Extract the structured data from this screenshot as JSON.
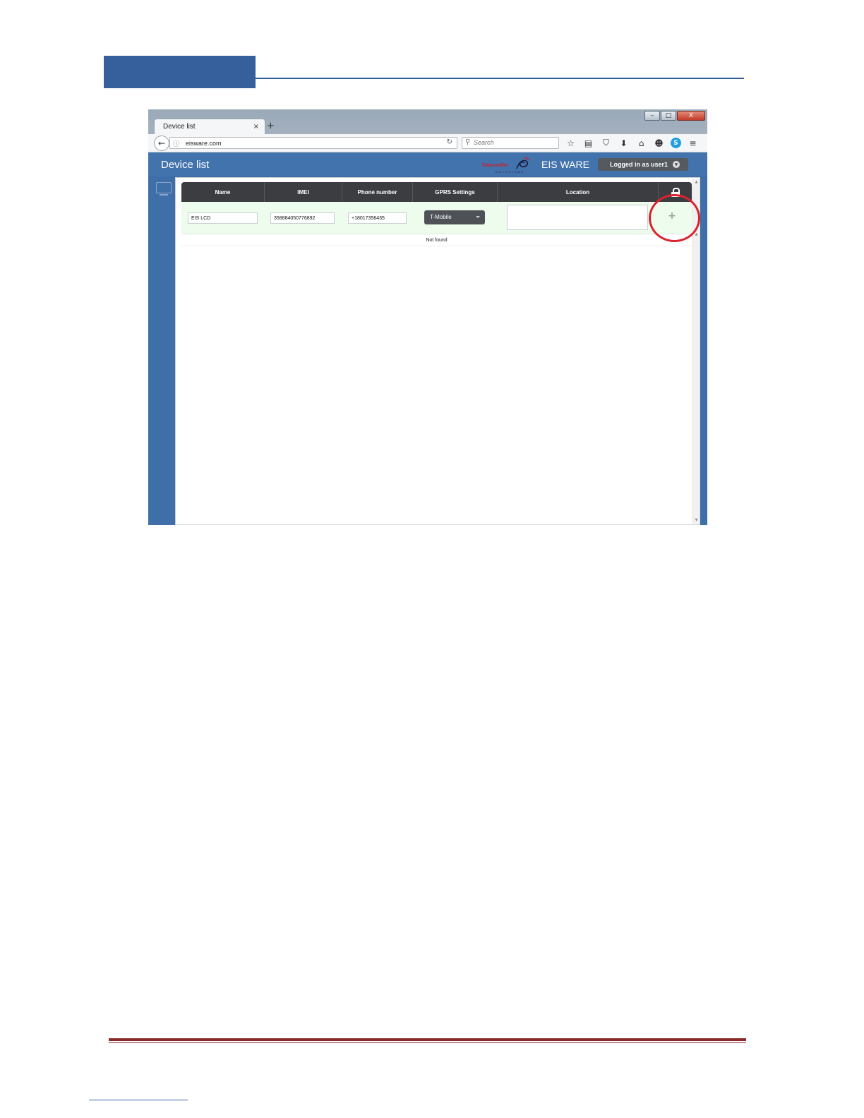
{
  "browser": {
    "tab_title": "Device list",
    "tab_close": "×",
    "new_tab": "+",
    "url": "eisware.com",
    "search_placeholder": "Search",
    "window_controls": {
      "minimize": "–",
      "maximize": "□",
      "close": "X"
    },
    "toolbar_icons": [
      "star-icon",
      "reading-list-icon",
      "pocket-icon",
      "download-icon",
      "home-icon",
      "chat-icon",
      "skype-icon",
      "menu-icon"
    ]
  },
  "app": {
    "title": "Device list",
    "logo_text": "Transmitter",
    "logo_sub": "SOLUTIONS",
    "brand": "EIS WARE",
    "user_menu": "Logged in as user1"
  },
  "table": {
    "columns": [
      "Name",
      "IMEI",
      "Phone number",
      "GPRS Settings",
      "Location"
    ],
    "new_row": {
      "name": "EIS LCD",
      "imei": "358884050776892",
      "phone": "+18017356435",
      "gprs": "T-Mobile",
      "location": "",
      "add_label": "+"
    },
    "empty_message": "Not found"
  },
  "colors": {
    "doc_accent": "#35609b",
    "footer_rule": "#8a2b2b",
    "app_blue": "#4273ad",
    "table_header": "#3b3d40",
    "new_row_bg": "#eefced",
    "highlight": "#d9232d"
  }
}
